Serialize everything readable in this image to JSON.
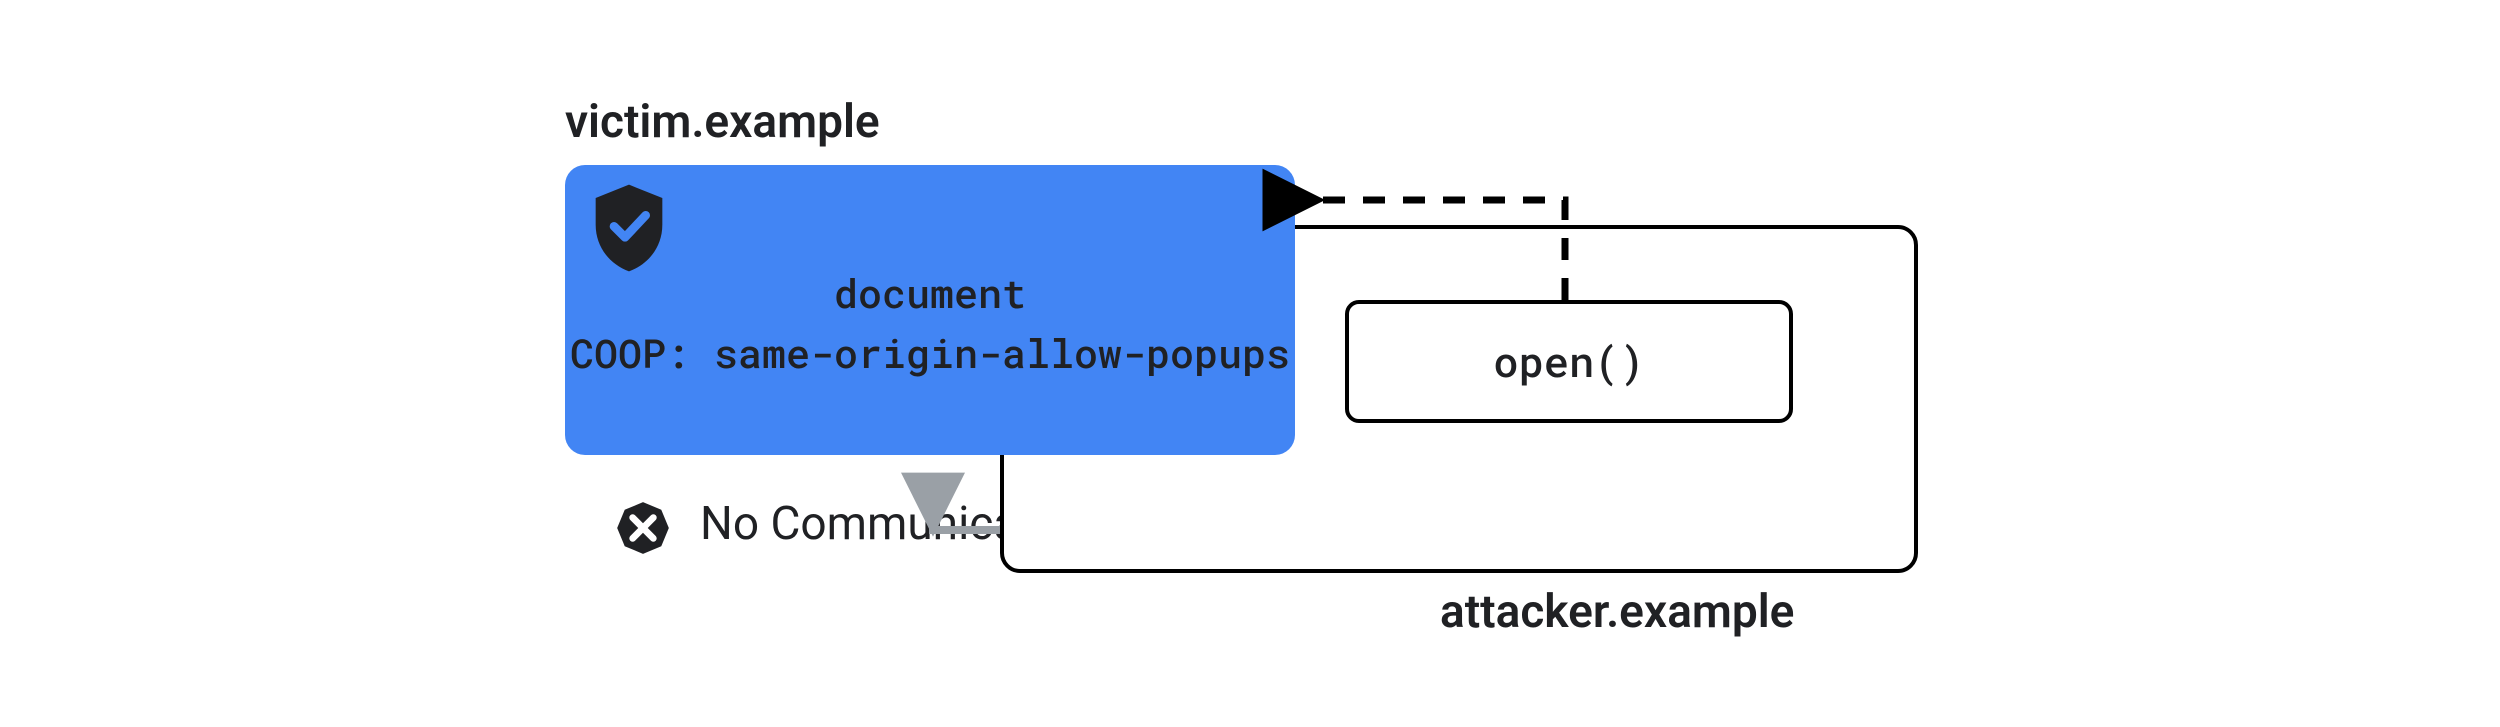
{
  "victim": {
    "title": "victim.example",
    "doc_line1": "document",
    "doc_line2": "COOP: same-origin-allow-popups"
  },
  "attacker": {
    "title": "attacker.example",
    "open_label": "open()"
  },
  "status": {
    "no_communication": "No Communication"
  },
  "icons": {
    "shield": "shield-check-icon",
    "deny": "deny-x-icon",
    "arrow_dashed": "dashed-arrow-icon",
    "arrow_gray": "gray-double-arrow-icon"
  },
  "colors": {
    "blue": "#4285f4",
    "text": "#202124",
    "gray_arrow": "#9aa0a6"
  }
}
